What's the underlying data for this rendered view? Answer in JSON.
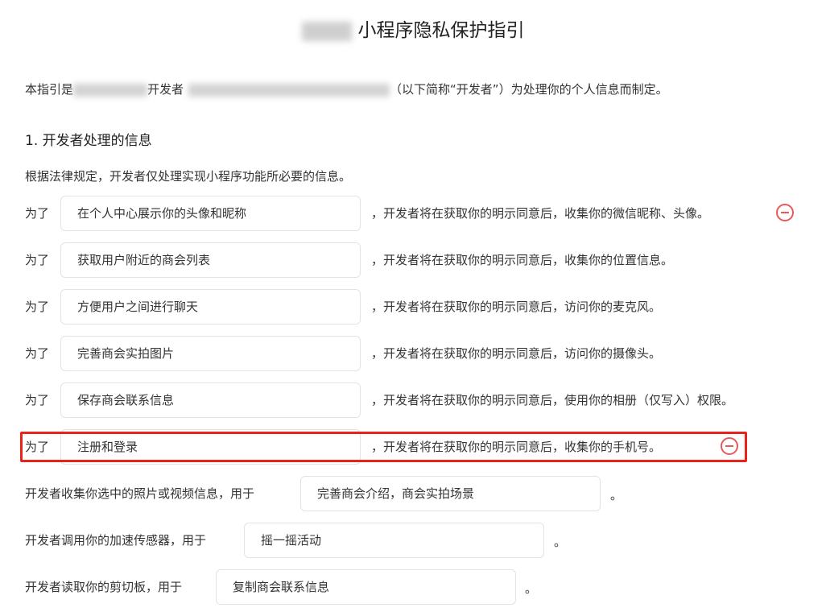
{
  "page": {
    "title": "小程序隐私保护指引",
    "intro_start": "本指引是",
    "intro_mid": "开发者",
    "intro_end": "（以下简称“开发者”）为处理你的个人信息而制定。"
  },
  "section1": {
    "title": "1. 开发者处理的信息",
    "description": "根据法律规定，开发者仅处理实现小程序功能所必要的信息。"
  },
  "purpose_rows": [
    {
      "prefix": "为了",
      "purpose": "在个人中心展示你的头像和昵称",
      "suffix": "，开发者将在获取你的明示同意后，收集你的微信昵称、头像。"
    },
    {
      "prefix": "为了",
      "purpose": "获取用户附近的商会列表",
      "suffix": "，开发者将在获取你的明示同意后，收集你的位置信息。"
    },
    {
      "prefix": "为了",
      "purpose": "方便用户之间进行聊天",
      "suffix": "，开发者将在获取你的明示同意后，访问你的麦克风。"
    },
    {
      "prefix": "为了",
      "purpose": "完善商会实拍图片",
      "suffix": "，开发者将在获取你的明示同意后，访问你的摄像头。"
    },
    {
      "prefix": "为了",
      "purpose": "保存商会联系信息",
      "suffix": "，开发者将在获取你的明示同意后，使用你的相册（仅写入）权限。"
    },
    {
      "prefix": "为了",
      "purpose": "注册和登录",
      "suffix": "，开发者将在获取你的明示同意后，收集你的手机号。"
    }
  ],
  "usage_rows": [
    {
      "prefix": "开发者收集你选中的照片或视频信息，用于",
      "purpose": "完善商会介绍，商会实拍场景",
      "suffix": "。"
    },
    {
      "prefix": "开发者调用你的加速传感器，用于",
      "purpose": "摇一摇活动",
      "suffix": "。"
    },
    {
      "prefix": "开发者读取你的剪切板，用于",
      "purpose": "复制商会联系信息",
      "suffix": "。"
    }
  ],
  "icons": {
    "remove": "minus-circle-icon"
  },
  "colors": {
    "remove_icon": "#e85a5a",
    "highlight": "#e8231a"
  }
}
